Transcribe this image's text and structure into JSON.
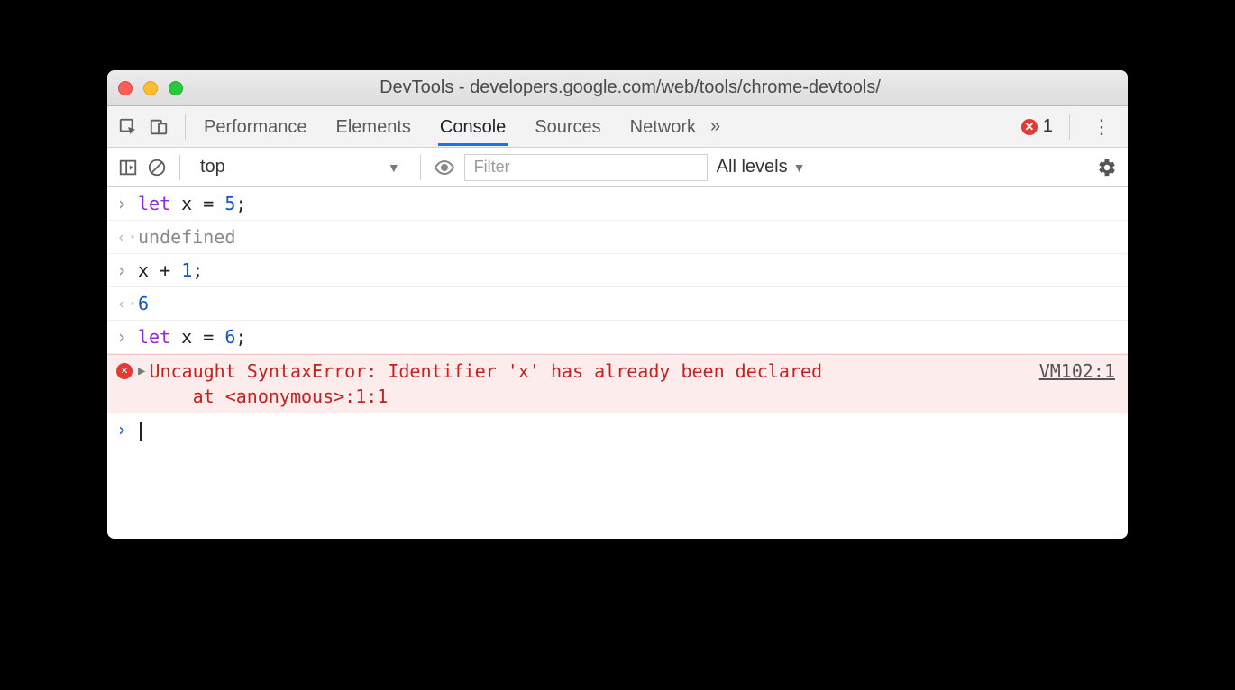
{
  "window": {
    "title": "DevTools - developers.google.com/web/tools/chrome-devtools/"
  },
  "tabs": {
    "items": [
      "Performance",
      "Elements",
      "Console",
      "Sources",
      "Network"
    ],
    "active": "Console",
    "overflow_glyph": "»"
  },
  "error_badge": {
    "count": "1"
  },
  "console_toolbar": {
    "context": "top",
    "filter_placeholder": "Filter",
    "levels_label": "All levels"
  },
  "console_rows": [
    {
      "type": "input",
      "tokens": [
        [
          "kw",
          "let"
        ],
        [
          "sp",
          " "
        ],
        [
          "id",
          "x"
        ],
        [
          "sp",
          " "
        ],
        [
          "op",
          "="
        ],
        [
          "sp",
          " "
        ],
        [
          "num",
          "5"
        ],
        [
          "op",
          ";"
        ]
      ]
    },
    {
      "type": "result",
      "tokens": [
        [
          "undef",
          "undefined"
        ]
      ]
    },
    {
      "type": "input",
      "tokens": [
        [
          "id",
          "x"
        ],
        [
          "sp",
          " "
        ],
        [
          "op",
          "+"
        ],
        [
          "sp",
          " "
        ],
        [
          "num",
          "1"
        ],
        [
          "op",
          ";"
        ]
      ]
    },
    {
      "type": "result",
      "tokens": [
        [
          "num",
          "6"
        ]
      ]
    },
    {
      "type": "input",
      "tokens": [
        [
          "kw",
          "let"
        ],
        [
          "sp",
          " "
        ],
        [
          "id",
          "x"
        ],
        [
          "sp",
          " "
        ],
        [
          "op",
          "="
        ],
        [
          "sp",
          " "
        ],
        [
          "num",
          "6"
        ],
        [
          "op",
          ";"
        ]
      ]
    },
    {
      "type": "error",
      "text": "Uncaught SyntaxError: Identifier 'x' has already been declared\n    at <anonymous>:1:1",
      "link": "VM102:1"
    },
    {
      "type": "prompt"
    }
  ],
  "colors": {
    "accent": "#1a73e8",
    "error": "#e53935",
    "error_bg": "#fdecec"
  }
}
